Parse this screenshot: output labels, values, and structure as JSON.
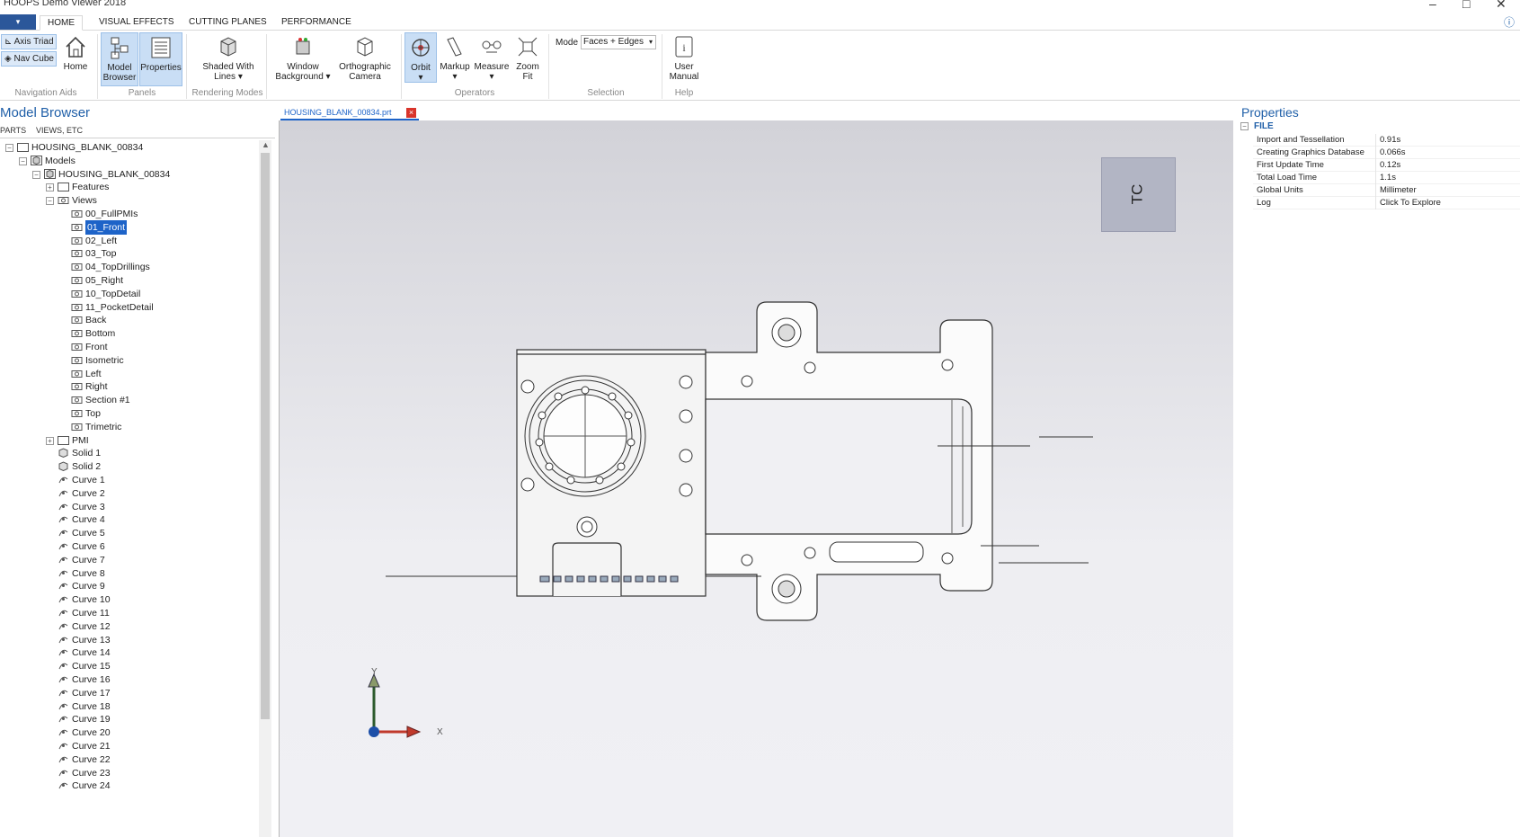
{
  "window": {
    "title": "HOOPS Demo Viewer 2018"
  },
  "ribbon": {
    "file_tab": "▾",
    "tabs": [
      "HOME",
      "VISUAL EFFECTS",
      "CUTTING PLANES",
      "PERFORMANCE"
    ],
    "axis_triad": "Axis Triad",
    "nav_cube": "Nav Cube",
    "home": "Home",
    "model_browser": "Model Browser",
    "properties": "Properties",
    "shaded": "Shaded With Lines",
    "window_bg": "Window Background",
    "ortho": "Orthographic Camera",
    "orbit": "Orbit",
    "markup": "Markup",
    "measure": "Measure",
    "zoom_fit": "Zoom Fit",
    "mode_label": "Mode",
    "mode_value": "Faces + Edges",
    "user_manual": "User Manual",
    "groups": {
      "nav_aids": "Navigation Aids",
      "panels": "Panels",
      "rendering": "Rendering Modes",
      "operators": "Operators",
      "selection": "Selection",
      "help": "Help"
    }
  },
  "model_browser": {
    "title": "Model Browser",
    "tabs": [
      "PARTS",
      "VIEWS, ETC"
    ],
    "tree": [
      {
        "label": "HOUSING_BLANK_00834",
        "level": 0,
        "toggle": "-",
        "icon": "folder"
      },
      {
        "label": "Models",
        "level": 1,
        "toggle": "-",
        "icon": "model"
      },
      {
        "label": "HOUSING_BLANK_00834",
        "level": 2,
        "toggle": "-",
        "icon": "model"
      },
      {
        "label": "Features",
        "level": 3,
        "toggle": "+",
        "icon": "folder"
      },
      {
        "label": "Views",
        "level": 3,
        "toggle": "-",
        "icon": "camera"
      },
      {
        "label": "00_FullPMIs",
        "level": 4,
        "icon": "camera"
      },
      {
        "label": "01_Front",
        "level": 4,
        "icon": "camera",
        "selected": true
      },
      {
        "label": "02_Left",
        "level": 4,
        "icon": "camera"
      },
      {
        "label": "03_Top",
        "level": 4,
        "icon": "camera"
      },
      {
        "label": "04_TopDrillings",
        "level": 4,
        "icon": "camera"
      },
      {
        "label": "05_Right",
        "level": 4,
        "icon": "camera"
      },
      {
        "label": "10_TopDetail",
        "level": 4,
        "icon": "camera"
      },
      {
        "label": "11_PocketDetail",
        "level": 4,
        "icon": "camera"
      },
      {
        "label": "Back",
        "level": 4,
        "icon": "camera"
      },
      {
        "label": "Bottom",
        "level": 4,
        "icon": "camera"
      },
      {
        "label": "Front",
        "level": 4,
        "icon": "camera"
      },
      {
        "label": "Isometric",
        "level": 4,
        "icon": "camera"
      },
      {
        "label": "Left",
        "level": 4,
        "icon": "camera"
      },
      {
        "label": "Right",
        "level": 4,
        "icon": "camera"
      },
      {
        "label": "Section #1",
        "level": 4,
        "icon": "camera"
      },
      {
        "label": "Top",
        "level": 4,
        "icon": "camera"
      },
      {
        "label": "Trimetric",
        "level": 4,
        "icon": "camera"
      },
      {
        "label": "PMI",
        "level": 3,
        "toggle": "+",
        "icon": "folder"
      },
      {
        "label": "Solid 1",
        "level": 3,
        "icon": "solid"
      },
      {
        "label": "Solid 2",
        "level": 3,
        "icon": "solid"
      },
      {
        "label": "Curve 1",
        "level": 3,
        "icon": "curve"
      },
      {
        "label": "Curve 2",
        "level": 3,
        "icon": "curve"
      },
      {
        "label": "Curve 3",
        "level": 3,
        "icon": "curve"
      },
      {
        "label": "Curve 4",
        "level": 3,
        "icon": "curve"
      },
      {
        "label": "Curve 5",
        "level": 3,
        "icon": "curve"
      },
      {
        "label": "Curve 6",
        "level": 3,
        "icon": "curve"
      },
      {
        "label": "Curve 7",
        "level": 3,
        "icon": "curve"
      },
      {
        "label": "Curve 8",
        "level": 3,
        "icon": "curve"
      },
      {
        "label": "Curve 9",
        "level": 3,
        "icon": "curve"
      },
      {
        "label": "Curve 10",
        "level": 3,
        "icon": "curve"
      },
      {
        "label": "Curve 11",
        "level": 3,
        "icon": "curve"
      },
      {
        "label": "Curve 12",
        "level": 3,
        "icon": "curve"
      },
      {
        "label": "Curve 13",
        "level": 3,
        "icon": "curve"
      },
      {
        "label": "Curve 14",
        "level": 3,
        "icon": "curve"
      },
      {
        "label": "Curve 15",
        "level": 3,
        "icon": "curve"
      },
      {
        "label": "Curve 16",
        "level": 3,
        "icon": "curve"
      },
      {
        "label": "Curve 17",
        "level": 3,
        "icon": "curve"
      },
      {
        "label": "Curve 18",
        "level": 3,
        "icon": "curve"
      },
      {
        "label": "Curve 19",
        "level": 3,
        "icon": "curve"
      },
      {
        "label": "Curve 20",
        "level": 3,
        "icon": "curve"
      },
      {
        "label": "Curve 21",
        "level": 3,
        "icon": "curve"
      },
      {
        "label": "Curve 22",
        "level": 3,
        "icon": "curve"
      },
      {
        "label": "Curve 23",
        "level": 3,
        "icon": "curve"
      },
      {
        "label": "Curve 24",
        "level": 3,
        "icon": "curve"
      }
    ]
  },
  "viewport": {
    "doc_tab": "HOUSING_BLANK_00834.prt",
    "doc_close": "×",
    "navcube_face": "TC",
    "axis_x": "X",
    "axis_y": "Y"
  },
  "properties": {
    "title": "Properties",
    "section": "FILE",
    "rows": [
      {
        "k": "Import and Tessellation",
        "v": "0.91s"
      },
      {
        "k": "Creating Graphics Database",
        "v": "0.066s"
      },
      {
        "k": "First Update Time",
        "v": "0.12s"
      },
      {
        "k": "Total Load Time",
        "v": "1.1s"
      },
      {
        "k": "Global Units",
        "v": "Millimeter"
      },
      {
        "k": "Log",
        "v": "Click To Explore"
      }
    ]
  },
  "colors": {
    "accent": "#1f5fa8",
    "file_tab": "#2b579a",
    "selection": "#1d63c8",
    "close": "#d9342b",
    "navcube": "#b2b5c4"
  }
}
